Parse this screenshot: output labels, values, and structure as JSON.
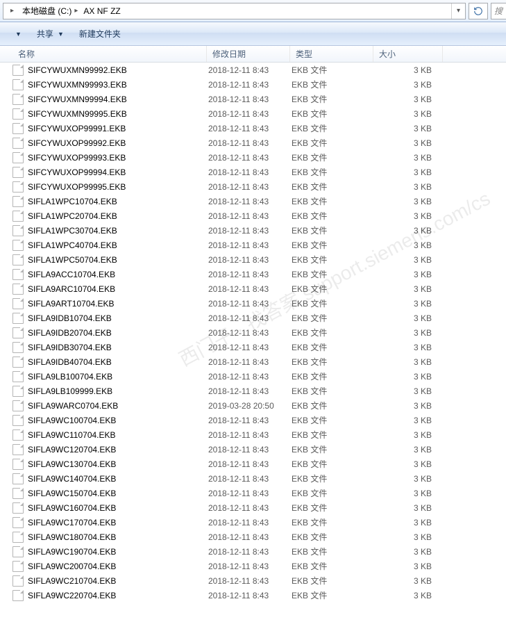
{
  "breadcrumb": {
    "items": [
      {
        "label": "本地磁盘 (C:)"
      },
      {
        "label": "AX NF ZZ"
      }
    ]
  },
  "search": {
    "placeholder": "搜"
  },
  "toolbar": {
    "share": "共享",
    "newfolder": "新建文件夹"
  },
  "columns": {
    "name": "名称",
    "date": "修改日期",
    "type": "类型",
    "size": "大小"
  },
  "files": [
    {
      "name": "SIFCYWUXMN99992.EKB",
      "date": "2018-12-11 8:43",
      "type": "EKB 文件",
      "size": "3 KB"
    },
    {
      "name": "SIFCYWUXMN99993.EKB",
      "date": "2018-12-11 8:43",
      "type": "EKB 文件",
      "size": "3 KB"
    },
    {
      "name": "SIFCYWUXMN99994.EKB",
      "date": "2018-12-11 8:43",
      "type": "EKB 文件",
      "size": "3 KB"
    },
    {
      "name": "SIFCYWUXMN99995.EKB",
      "date": "2018-12-11 8:43",
      "type": "EKB 文件",
      "size": "3 KB"
    },
    {
      "name": "SIFCYWUXOP99991.EKB",
      "date": "2018-12-11 8:43",
      "type": "EKB 文件",
      "size": "3 KB"
    },
    {
      "name": "SIFCYWUXOP99992.EKB",
      "date": "2018-12-11 8:43",
      "type": "EKB 文件",
      "size": "3 KB"
    },
    {
      "name": "SIFCYWUXOP99993.EKB",
      "date": "2018-12-11 8:43",
      "type": "EKB 文件",
      "size": "3 KB"
    },
    {
      "name": "SIFCYWUXOP99994.EKB",
      "date": "2018-12-11 8:43",
      "type": "EKB 文件",
      "size": "3 KB"
    },
    {
      "name": "SIFCYWUXOP99995.EKB",
      "date": "2018-12-11 8:43",
      "type": "EKB 文件",
      "size": "3 KB"
    },
    {
      "name": "SIFLA1WPC10704.EKB",
      "date": "2018-12-11 8:43",
      "type": "EKB 文件",
      "size": "3 KB"
    },
    {
      "name": "SIFLA1WPC20704.EKB",
      "date": "2018-12-11 8:43",
      "type": "EKB 文件",
      "size": "3 KB"
    },
    {
      "name": "SIFLA1WPC30704.EKB",
      "date": "2018-12-11 8:43",
      "type": "EKB 文件",
      "size": "3 KB"
    },
    {
      "name": "SIFLA1WPC40704.EKB",
      "date": "2018-12-11 8:43",
      "type": "EKB 文件",
      "size": "3 KB"
    },
    {
      "name": "SIFLA1WPC50704.EKB",
      "date": "2018-12-11 8:43",
      "type": "EKB 文件",
      "size": "3 KB"
    },
    {
      "name": "SIFLA9ACC10704.EKB",
      "date": "2018-12-11 8:43",
      "type": "EKB 文件",
      "size": "3 KB"
    },
    {
      "name": "SIFLA9ARC10704.EKB",
      "date": "2018-12-11 8:43",
      "type": "EKB 文件",
      "size": "3 KB"
    },
    {
      "name": "SIFLA9ART10704.EKB",
      "date": "2018-12-11 8:43",
      "type": "EKB 文件",
      "size": "3 KB"
    },
    {
      "name": "SIFLA9IDB10704.EKB",
      "date": "2018-12-11 8:43",
      "type": "EKB 文件",
      "size": "3 KB"
    },
    {
      "name": "SIFLA9IDB20704.EKB",
      "date": "2018-12-11 8:43",
      "type": "EKB 文件",
      "size": "3 KB"
    },
    {
      "name": "SIFLA9IDB30704.EKB",
      "date": "2018-12-11 8:43",
      "type": "EKB 文件",
      "size": "3 KB"
    },
    {
      "name": "SIFLA9IDB40704.EKB",
      "date": "2018-12-11 8:43",
      "type": "EKB 文件",
      "size": "3 KB"
    },
    {
      "name": "SIFLA9LB100704.EKB",
      "date": "2018-12-11 8:43",
      "type": "EKB 文件",
      "size": "3 KB"
    },
    {
      "name": "SIFLA9LB109999.EKB",
      "date": "2018-12-11 8:43",
      "type": "EKB 文件",
      "size": "3 KB"
    },
    {
      "name": "SIFLA9WARC0704.EKB",
      "date": "2019-03-28 20:50",
      "type": "EKB 文件",
      "size": "3 KB"
    },
    {
      "name": "SIFLA9WC100704.EKB",
      "date": "2018-12-11 8:43",
      "type": "EKB 文件",
      "size": "3 KB"
    },
    {
      "name": "SIFLA9WC110704.EKB",
      "date": "2018-12-11 8:43",
      "type": "EKB 文件",
      "size": "3 KB"
    },
    {
      "name": "SIFLA9WC120704.EKB",
      "date": "2018-12-11 8:43",
      "type": "EKB 文件",
      "size": "3 KB"
    },
    {
      "name": "SIFLA9WC130704.EKB",
      "date": "2018-12-11 8:43",
      "type": "EKB 文件",
      "size": "3 KB"
    },
    {
      "name": "SIFLA9WC140704.EKB",
      "date": "2018-12-11 8:43",
      "type": "EKB 文件",
      "size": "3 KB"
    },
    {
      "name": "SIFLA9WC150704.EKB",
      "date": "2018-12-11 8:43",
      "type": "EKB 文件",
      "size": "3 KB"
    },
    {
      "name": "SIFLA9WC160704.EKB",
      "date": "2018-12-11 8:43",
      "type": "EKB 文件",
      "size": "3 KB"
    },
    {
      "name": "SIFLA9WC170704.EKB",
      "date": "2018-12-11 8:43",
      "type": "EKB 文件",
      "size": "3 KB"
    },
    {
      "name": "SIFLA9WC180704.EKB",
      "date": "2018-12-11 8:43",
      "type": "EKB 文件",
      "size": "3 KB"
    },
    {
      "name": "SIFLA9WC190704.EKB",
      "date": "2018-12-11 8:43",
      "type": "EKB 文件",
      "size": "3 KB"
    },
    {
      "name": "SIFLA9WC200704.EKB",
      "date": "2018-12-11 8:43",
      "type": "EKB 文件",
      "size": "3 KB"
    },
    {
      "name": "SIFLA9WC210704.EKB",
      "date": "2018-12-11 8:43",
      "type": "EKB 文件",
      "size": "3 KB"
    },
    {
      "name": "SIFLA9WC220704.EKB",
      "date": "2018-12-11 8:43",
      "type": "EKB 文件",
      "size": "3 KB"
    }
  ],
  "watermark": "西门子 · 找答案 support.siemens.com/cs"
}
